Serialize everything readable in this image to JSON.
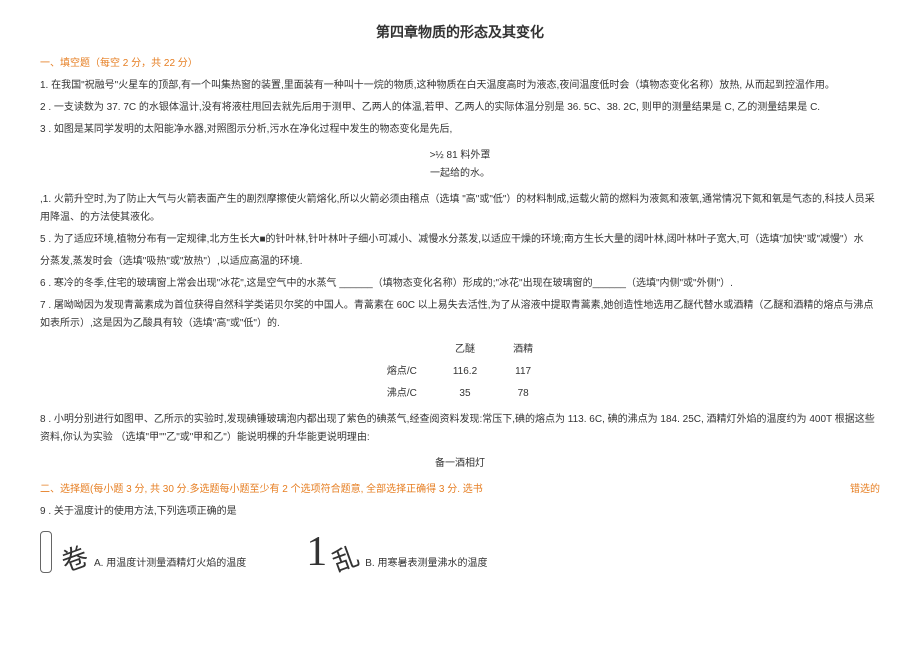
{
  "title": "第四章物质的形态及其变化",
  "section1": "一、填空题（每空 2 分，共 22 分）",
  "q1": "1. 在我国\"祝融号\"火星车的顶部,有一个叫集热窗的装置,里面装有一种叫十一烷的物质,这种物质在白天温度高时为液态,夜间温度低时会（填物态变化名称）放热, 从而起到控温作用。",
  "q2": "2 . 一支读数为 37. 7C 的水银体温计,没有将液柱甩回去就先后用于测甲、乙两人的体温,若甲、乙两人的实际体温分别是 36. 5C、38. 2C, 则甲的测量结果是 C, 乙的测量结果是 C.",
  "q3": "3 . 如图是某同学发明的太阳能净水器,对照图示分析,污水在净化过程中发生的物态变化是先后,",
  "diagram_label_top": ">½     81 料外罩",
  "diagram_label_bot": "一起给的水。",
  "q4": ",1. 火箭升空时,为了防止大气与火箭表面产生的剧烈摩擦使火箭熔化,所以火箭必须由稽点（选填 \"高\"或\"低\"）的材料制成,运载火箭的燃料为液氮和液氧,通常情况下氮和氧是气态的,科技人员采用降温、的方法使其液化。",
  "q5": "5 . 为了适应环境,植物分布有一定规律,北方生长大■的针叶林,针叶林叶子细小可减小、减慢水分蒸发,以适应干燥的环境;南方生长大量的阔叶林,阔叶林叶子宽大,可（选填\"加快\"或\"减慢\"）水",
  "q5b": "分蒸发,蒸发时会（选填\"吸热\"或\"放热\"）,以适应高温的环境.",
  "q6": "6 . 寒冷的冬季,住宅的玻璃窗上常会出现\"冰花\",这是空气中的水蒸气 ______（填物态变化名称）形成的;\"冰花\"出现在玻璃窗的______（选填\"内侧\"或\"外侧\"）.",
  "q7": "7 . 屠呦呦因为发现青蒿素成为首位获得自然科学类诺贝尔奖的中国人。青蒿素在 60C 以上易失去活性,为了从溶液中提取青蒿素,她创造性地选用乙醚代替水或酒精（乙醚和酒精的熔点与沸点如表所示）,这是因为乙酸具有较（选填\"高\"或\"低\"）的.",
  "table": {
    "h1": "乙醚",
    "h2": "酒精",
    "r1l": "熔点/C",
    "r1a": "116.2",
    "r1b": "117",
    "r2l": "沸点/C",
    "r2a": "35",
    "r2b": "78"
  },
  "q8": "8 . 小明分别进行如图甲、乙所示的实验时,发现碘锤玻璃泡内都出现了紫色的碘蒸气,经查阅资料发现:常压下,碘的熔点为 113. 6C, 碘的沸点为 184. 25C, 酒精灯外焰的温度约为 400T 根据这些资料,你认为实验 （选填\"甲\"\"乙\"或\"甲和乙\"）能说明棵的升华能更说明理由:",
  "q8_label": "备一酒相灯",
  "section2_left": "二、选择题(每小题 3 分, 共 30 分.多选题每小题至少有 2 个选项符合题意, 全部选择正确得 3 分. 选书",
  "section2_right": "错选的",
  "q9": "9 . 关于温度计的使用方法,下列选项正确的是",
  "q9a": "A. 用温度计测量酒精灯火焰的温度",
  "q9b": "B. 用寒暑表测量沸水的温度",
  "glyph_scroll": "卷",
  "glyph_one": "1",
  "glyph_messy": "乱"
}
